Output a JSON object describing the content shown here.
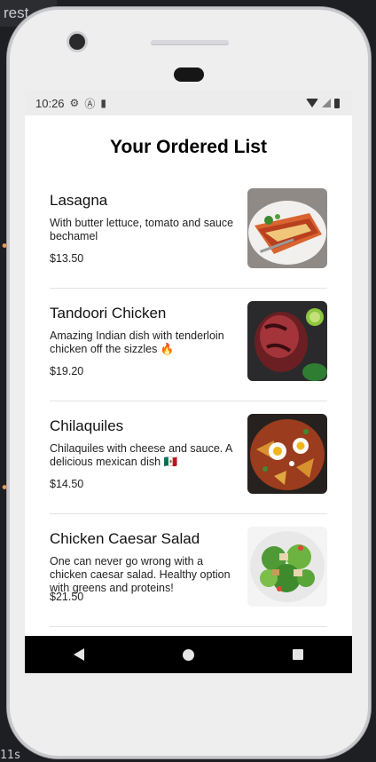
{
  "editor_backdrop": {
    "tab_text": "rest",
    "bottom_text": "11s"
  },
  "status_bar": {
    "time": "10:26",
    "icons": [
      "gear-icon",
      "a-icon",
      "sd-card-icon"
    ],
    "right_icons": [
      "wifi-icon",
      "signal-icon",
      "battery-icon"
    ]
  },
  "page": {
    "title": "Your Ordered List"
  },
  "orders": [
    {
      "name": "Lasagna",
      "description": "With butter lettuce, tomato and sauce bechamel",
      "price": "$13.50",
      "image": "lasagna-photo"
    },
    {
      "name": "Tandoori Chicken",
      "description": "Amazing Indian dish with tenderloin chicken off the sizzles 🔥",
      "price": "$19.20",
      "image": "tandoori-chicken-photo"
    },
    {
      "name": "Chilaquiles",
      "description": "Chilaquiles with cheese and sauce. A delicious mexican dish 🇲🇽",
      "price": "$14.50",
      "image": "chilaquiles-photo"
    },
    {
      "name": "Chicken Caesar Salad",
      "description": "One can never go wrong with a chicken caesar salad. Healthy option with greens and proteins!",
      "price": "$21.50",
      "image": "caesar-salad-photo"
    }
  ],
  "nav_bar": {
    "buttons": [
      "back-icon",
      "home-icon",
      "recents-icon"
    ]
  }
}
